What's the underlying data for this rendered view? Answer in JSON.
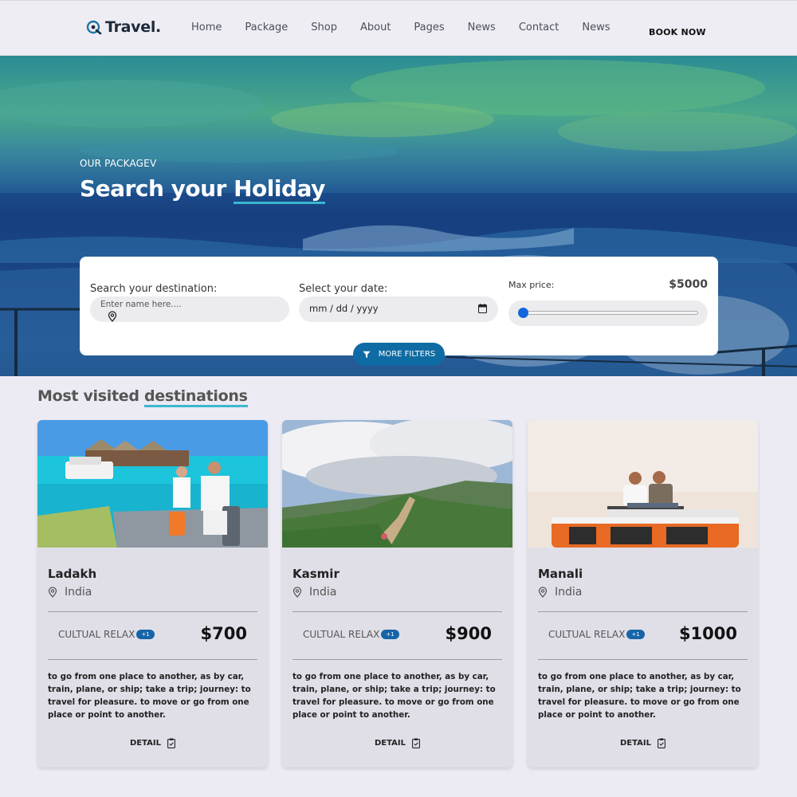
{
  "header": {
    "logo_text": "Travel.",
    "nav": [
      "Home",
      "Package",
      "Shop",
      "About",
      "Pages",
      "News",
      "Contact",
      "News"
    ],
    "book_now": "BOOK NOW"
  },
  "hero": {
    "eyebrow": "OUR PACKAGEV",
    "title_start": "Search your ",
    "title_highlight": "Holiday"
  },
  "search": {
    "destination_label": "Search your destination:",
    "destination_placeholder": "Enter name here....",
    "date_label": "Select your date:",
    "date_value": "mm / dd / yyyy",
    "max_price_label": "Max price:",
    "max_price_value": "$5000",
    "slider_fraction": 0,
    "more_filters": "MORE FILTERS"
  },
  "section": {
    "title_start": "Most visited ",
    "title_highlight": "destinations"
  },
  "cards": [
    {
      "name": "Ladakh",
      "location": "India",
      "tag": "CULTUAL RELAX",
      "badge": "+1",
      "price": "$700",
      "description": "to go from one place to another, as by car, train, plane, or ship; take a trip; journey: to travel for pleasure. to move or go from one place or point to another.",
      "detail": "DETAIL"
    },
    {
      "name": "Kasmir",
      "location": "India",
      "tag": "CULTUAL RELAX",
      "badge": "+1",
      "price": "$900",
      "description": "to go from one place to another, as by car, train, plane, or ship; take a trip; journey: to travel for pleasure. to move or go from one place or point to another.",
      "detail": "DETAIL"
    },
    {
      "name": "Manali",
      "location": "India",
      "tag": "CULTUAL RELAX",
      "badge": "+1",
      "price": "$1000",
      "description": "to go from one place to another, as by car, train, plane, or ship; take a trip; journey: to travel for pleasure. to move or go from one place or point to another.",
      "detail": "DETAIL"
    }
  ],
  "colors": {
    "accent": "#0f6ba3",
    "highlight_underline": "#3bb7d0",
    "badge": "#1565a8",
    "slider_knob": "#1166dd"
  }
}
